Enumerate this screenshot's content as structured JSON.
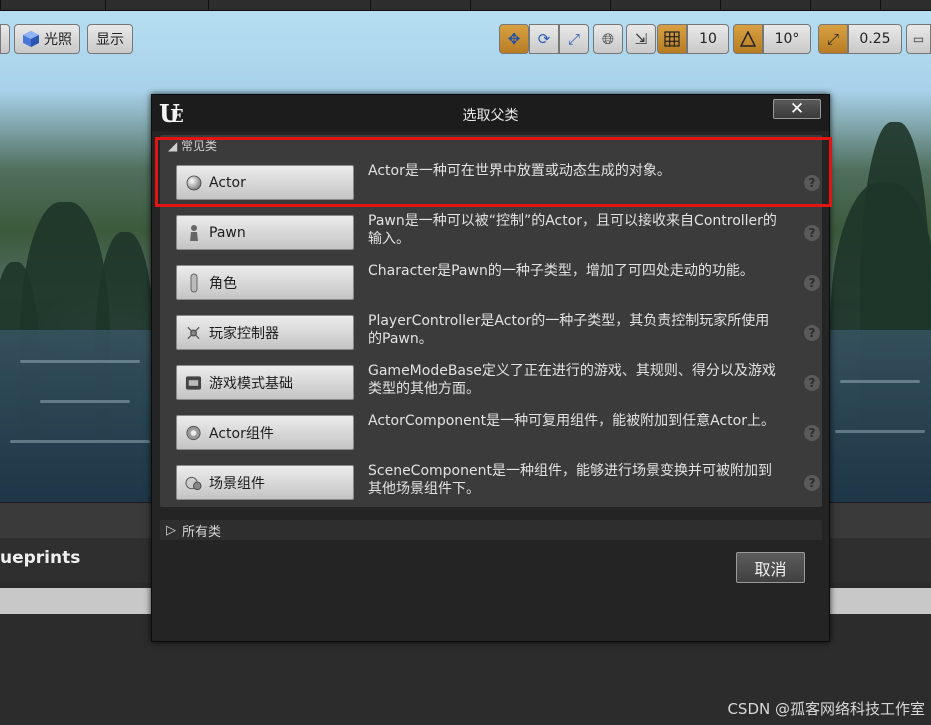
{
  "toolbar": {
    "lit_label": "光照",
    "show_label": "显示",
    "grid_snap_value": "10",
    "rotation_snap_value": "10°",
    "scale_snap_value": "0.25"
  },
  "dialog": {
    "title": "选取父类",
    "close_label": "✕",
    "section_label": "常见类",
    "all_classes_label": "所有类",
    "cancel_label": "取消",
    "help_label": "?",
    "classes": [
      {
        "name": "Actor",
        "icon": "actor-sphere-icon",
        "description": "Actor是一种可在世界中放置或动态生成的对象。"
      },
      {
        "name": "Pawn",
        "icon": "pawn-icon",
        "description": "Pawn是一种可以被“控制”的Actor，且可以接收来自Controller的输入。"
      },
      {
        "name": "角色",
        "icon": "character-icon",
        "description": "Character是Pawn的一种子类型，增加了可四处走动的功能。"
      },
      {
        "name": "玩家控制器",
        "icon": "player-controller-icon",
        "description": "PlayerController是Actor的一种子类型，其负责控制玩家所使用的Pawn。"
      },
      {
        "name": "游戏模式基础",
        "icon": "game-mode-icon",
        "description": "GameModeBase定义了正在进行的游戏、其规则、得分以及游戏类型的其他方面。"
      },
      {
        "name": "Actor组件",
        "icon": "actor-component-icon",
        "description": "ActorComponent是一种可复用组件，能被附加到任意Actor上。"
      },
      {
        "name": "场景组件",
        "icon": "scene-component-icon",
        "description": "SceneComponent是一种组件，能够进行场景变换并可被附加到其他场景组件下。"
      }
    ]
  },
  "editor": {
    "blueprints_label": "ueprints"
  },
  "watermark": "CSDN @孤客网络科技工作室",
  "colors": {
    "highlight_border": "#e21414",
    "snap_accent": "#c88a2d"
  }
}
